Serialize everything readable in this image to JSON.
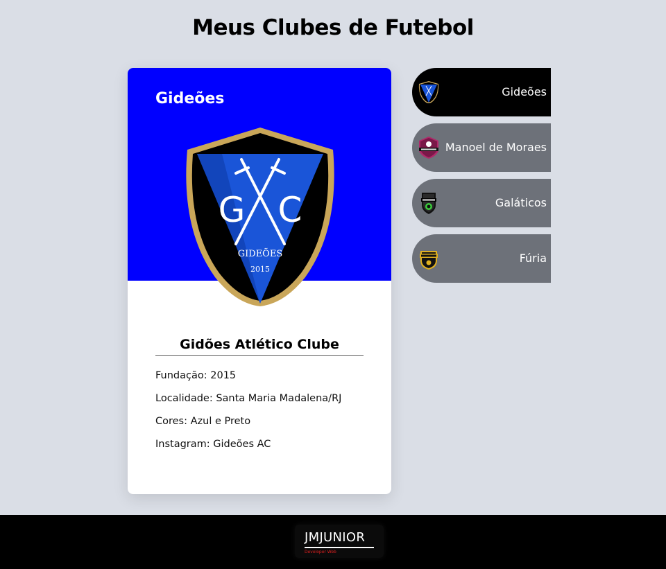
{
  "page": {
    "title": "Meus Clubes de Futebol"
  },
  "card": {
    "name": "Gideões",
    "header_color": "#0000ff",
    "crest_text": {
      "initials_left": "G",
      "initials_right": "C",
      "club": "GIDEÕES",
      "year": "2015"
    },
    "full_name": "Gidões Atlético Clube",
    "info": [
      {
        "label": "Fundação:",
        "value": "2015"
      },
      {
        "label": "Localidade:",
        "value": "Santa Maria Madalena/RJ"
      },
      {
        "label": "Cores:",
        "value": "Azul e Preto"
      },
      {
        "label": "Instagram:",
        "value": "Gideões AC"
      }
    ]
  },
  "clubs": [
    {
      "label": "Gideões",
      "active": true,
      "icon": "gideoes-crest-icon"
    },
    {
      "label": "Manoel de Moraes",
      "active": false,
      "icon": "manoel-de-moraes-crest-icon"
    },
    {
      "label": "Galáticos",
      "active": false,
      "icon": "galaticos-crest-icon"
    },
    {
      "label": "Fúria",
      "active": false,
      "icon": "furia-crest-icon"
    }
  ],
  "footer": {
    "brand": "JMJUNIOR",
    "tagline": "Developer Web"
  },
  "colors": {
    "background": "#dadee6",
    "nav_inactive": "#6d7179",
    "nav_active": "#000000",
    "accent_red": "#e02020"
  }
}
